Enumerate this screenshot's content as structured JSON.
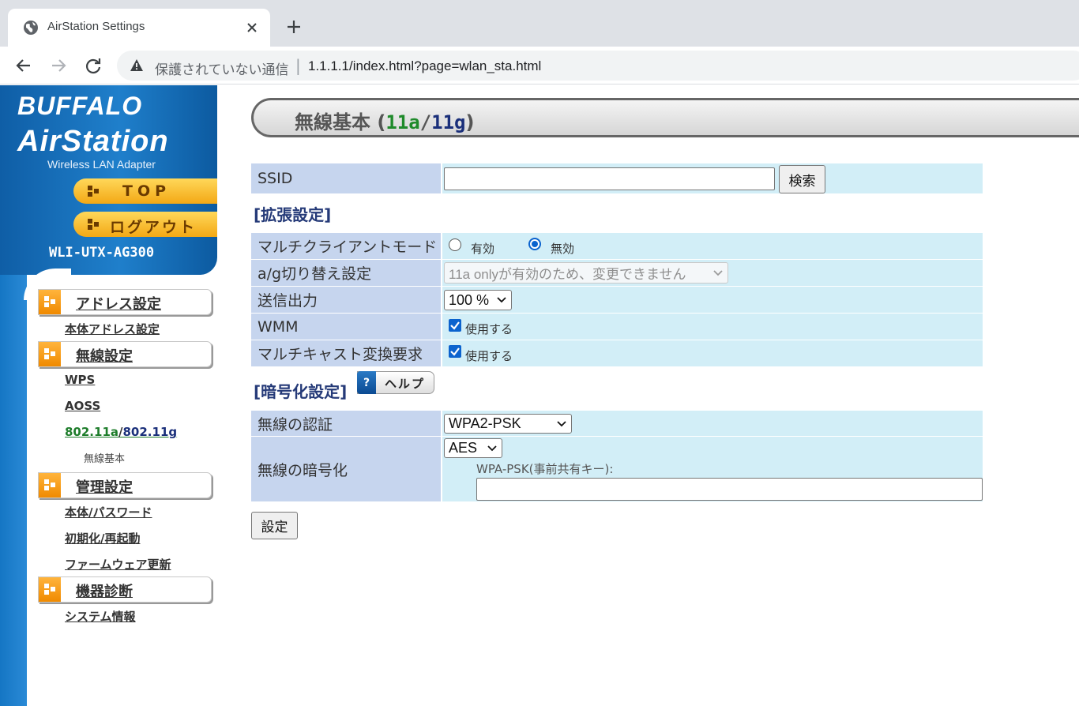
{
  "browser": {
    "tab_title": "AirStation Settings",
    "security_label": "保護されていない通信",
    "separator": "|",
    "url": "1.1.1.1/index.html?page=wlan_sta.html"
  },
  "sidebar": {
    "brand": "BUFFALO",
    "product": "AirStation",
    "subtitle": "Wireless LAN Adapter",
    "top_button": "TOP",
    "logout_button": "ログアウト",
    "model": "WLI-UTX-AG300",
    "sections": [
      {
        "label": "アドレス設定",
        "items": [
          "本体アドレス設定"
        ]
      },
      {
        "label": "無線設定",
        "items": [
          "WPS",
          "AOSS"
        ]
      },
      {
        "label": "管理設定",
        "items": [
          "本体/パスワード",
          "初期化/再起動",
          "ファームウェア更新"
        ]
      },
      {
        "label": "機器診断",
        "items": [
          "システム情報"
        ]
      }
    ],
    "wireless_mode": {
      "a": "802.11a",
      "slash": "/",
      "g": "802.11g",
      "sub": "無線基本"
    }
  },
  "page": {
    "title_prefix": "無線基本 (",
    "title_a": "11a",
    "title_slash": "/",
    "title_g": "11g",
    "title_suffix": ")"
  },
  "ssid": {
    "label": "SSID",
    "value": "",
    "search_button": "検索"
  },
  "extended": {
    "heading": "[拡張設定]",
    "multiclient": {
      "label": "マルチクライアントモード",
      "opt_on": "有効",
      "opt_off": "無効",
      "selected": "無効"
    },
    "ag_switch": {
      "label": "a/g切り替え設定",
      "value": "11a onlyが有効のため、変更できません"
    },
    "tx_power": {
      "label": "送信出力",
      "value": "100 %"
    },
    "wmm": {
      "label": "WMM",
      "checkbox_label": "使用する",
      "checked": true
    },
    "multicast": {
      "label": "マルチキャスト変換要求",
      "checkbox_label": "使用する",
      "checked": true
    }
  },
  "encryption": {
    "heading": "[暗号化設定]",
    "help_q": "?",
    "help_label": "ヘルプ",
    "auth": {
      "label": "無線の認証",
      "value": "WPA2-PSK"
    },
    "cipher": {
      "label": "無線の暗号化",
      "value": "AES",
      "psk_label": "WPA-PSK(事前共有キー):",
      "psk_value": ""
    }
  },
  "submit_button": "設定",
  "colors": {
    "label_cell": "#c6d5ee",
    "value_cell": "#d2eef7",
    "accent_11a": "#1e8a2a",
    "accent_11g": "#1a2f7a",
    "section_heading": "#253a78"
  }
}
